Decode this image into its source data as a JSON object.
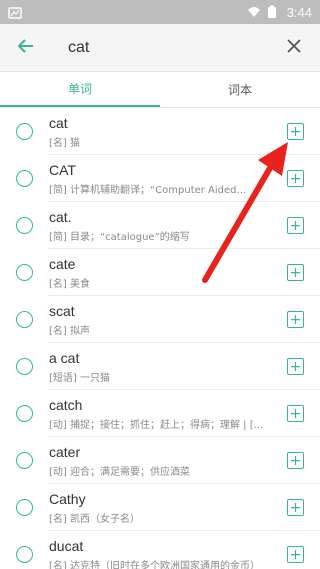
{
  "status": {
    "time": "3:44"
  },
  "search": {
    "query": "cat"
  },
  "tabs": [
    {
      "label": "单词",
      "active": true
    },
    {
      "label": "词本",
      "active": false
    }
  ],
  "results": [
    {
      "word": "cat",
      "def": "[名] 猫"
    },
    {
      "word": "CAT",
      "def": "[简] 计算机辅助翻译；“Computer Aided..."
    },
    {
      "word": "cat.",
      "def": "[简] 目录；“catalogue”的缩写"
    },
    {
      "word": "cate",
      "def": "[名] 美食"
    },
    {
      "word": "scat",
      "def": "[名] 拟声"
    },
    {
      "word": "a cat",
      "def": "[短语] 一只猫"
    },
    {
      "word": "catch",
      "def": "[动] 捕捉；接住；抓住；赶上；得病；理解 | [..."
    },
    {
      "word": "cater",
      "def": "[动] 迎合；满足需要；供应酒菜"
    },
    {
      "word": "Cathy",
      "def": "[名] 凯西（女子名）"
    },
    {
      "word": "ducat",
      "def": "[名] 达克特（旧时在多个欧洲国家通用的金币）"
    }
  ],
  "colors": {
    "accent": "#37b59b",
    "arrow": "#e8231e"
  },
  "icons": {
    "back": "arrow-left-icon",
    "clear": "close-icon",
    "add": "plus-square-icon"
  }
}
